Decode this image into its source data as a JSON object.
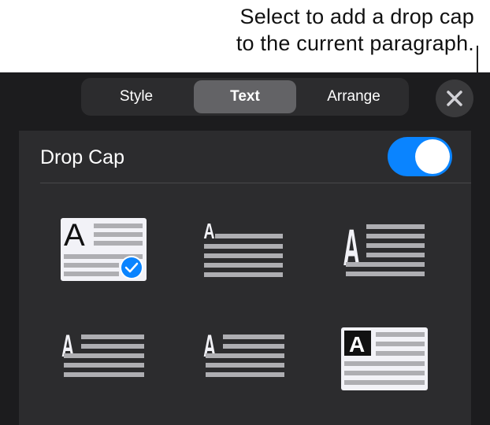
{
  "callout": {
    "line1": "Select to add a drop cap",
    "line2": "to the current paragraph."
  },
  "tabs": [
    {
      "label": "Style",
      "active": false
    },
    {
      "label": "Text",
      "active": true
    },
    {
      "label": "Arrange",
      "active": false
    }
  ],
  "close_icon": "close-icon",
  "drop_cap": {
    "label": "Drop Cap",
    "enabled": true
  },
  "styles": [
    {
      "letter": "A",
      "selected": true
    },
    {
      "letter": "A",
      "selected": false
    },
    {
      "letter": "A",
      "selected": false
    },
    {
      "letter": "A",
      "selected": false
    },
    {
      "letter": "A",
      "selected": false
    },
    {
      "letter": "A",
      "selected": false
    }
  ],
  "colors": {
    "accent": "#0a84ff",
    "panel": "#1c1c1e",
    "sheet": "#2c2c2e"
  }
}
